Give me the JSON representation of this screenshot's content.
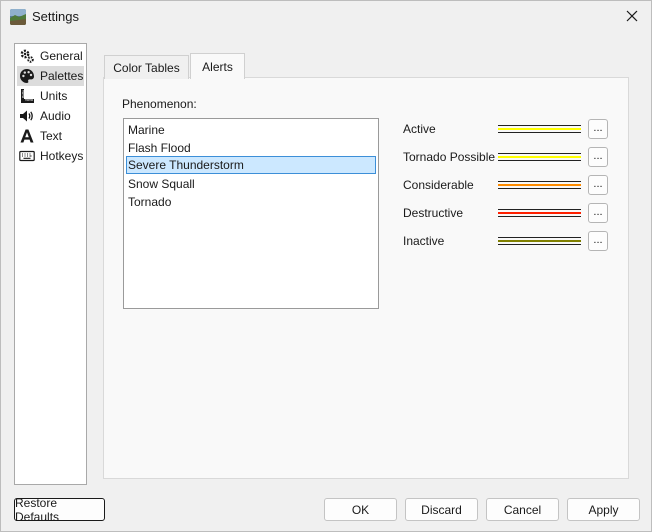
{
  "window": {
    "title": "Settings"
  },
  "sidebar": {
    "items": [
      {
        "label": "General",
        "icon": "gears-icon"
      },
      {
        "label": "Palettes",
        "icon": "palette-icon"
      },
      {
        "label": "Units",
        "icon": "ruler-icon"
      },
      {
        "label": "Audio",
        "icon": "speaker-icon"
      },
      {
        "label": "Text",
        "icon": "text-icon"
      },
      {
        "label": "Hotkeys",
        "icon": "keyboard-icon"
      }
    ],
    "selected": "Palettes"
  },
  "tabs": [
    {
      "label": "Color Tables"
    },
    {
      "label": "Alerts"
    }
  ],
  "active_tab": "Alerts",
  "alerts": {
    "phenomenon_label": "Phenomenon:",
    "phenomena": [
      "Marine",
      "Flash Flood",
      "Severe Thunderstorm",
      "Snow Squall",
      "Tornado"
    ],
    "selected_phenomenon": "Severe Thunderstorm",
    "palette_rows": [
      {
        "label": "Active",
        "color_outer": "#1a1a1a",
        "color_inner": "#ffff00",
        "button": "..."
      },
      {
        "label": "Tornado Possible",
        "color_outer": "#1a1a1a",
        "color_inner": "#ffff00",
        "button": "..."
      },
      {
        "label": "Considerable",
        "color_outer": "#1a1a1a",
        "color_inner": "#ff8c00",
        "button": "..."
      },
      {
        "label": "Destructive",
        "color_outer": "#1a1a1a",
        "color_inner": "#ff2000",
        "button": "..."
      },
      {
        "label": "Inactive",
        "color_outer": "#1a1a1a",
        "color_inner": "#808000",
        "button": "..."
      }
    ]
  },
  "buttons": {
    "restore_defaults": "Restore Defaults",
    "ok": "OK",
    "discard": "Discard",
    "cancel": "Cancel",
    "apply": "Apply"
  }
}
